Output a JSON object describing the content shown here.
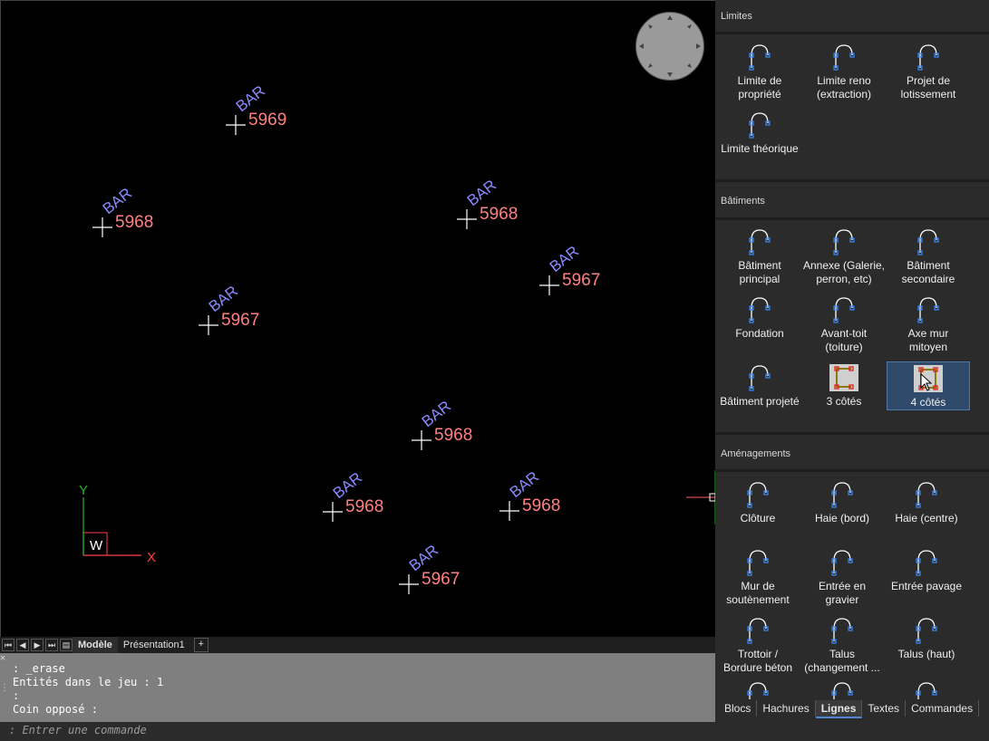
{
  "canvas": {
    "labels": [
      {
        "code": "BAR",
        "number": "5969"
      },
      {
        "code": "BAR",
        "number": "5968"
      },
      {
        "code": "BAR",
        "number": "5968"
      },
      {
        "code": "BAR",
        "number": "5967"
      },
      {
        "code": "BAR",
        "number": "5967"
      },
      {
        "code": "BAR",
        "number": "5968"
      },
      {
        "code": "BAR",
        "number": "5968"
      },
      {
        "code": "BAR",
        "number": "5968"
      },
      {
        "code": "BAR",
        "number": "5967"
      }
    ],
    "ucs": {
      "y": "Y",
      "x": "X",
      "w": "W"
    },
    "colors": {
      "code": "#8a8aff",
      "number": "#ff8080",
      "cross": "#ffffff",
      "axis_y": "#2ab52a",
      "axis_x": "#ff4040"
    }
  },
  "layout_tabs": {
    "model": "Modèle",
    "layout1": "Présentation1",
    "add": "+"
  },
  "command": {
    "history": [
      ": _erase",
      "Entités dans le jeu : 1",
      ":",
      "Coin opposé :"
    ],
    "prompt": ": Entrer une commande"
  },
  "panel": {
    "sections": [
      {
        "title": "Limites"
      },
      {
        "title": "Bâtiments"
      },
      {
        "title": "Aménagements"
      }
    ],
    "limites": [
      {
        "label": "Limite de\npropriété",
        "icon": "arc-line-icon"
      },
      {
        "label": "Limite reno\n(extraction)",
        "icon": "arc-line-icon"
      },
      {
        "label": "Projet de\nlotissement",
        "icon": "arc-line-icon"
      },
      {
        "label": "Limite théorique",
        "icon": "arc-line-icon"
      }
    ],
    "batiments": [
      {
        "label": "Bâtiment\nprincipal",
        "icon": "arc-line-icon"
      },
      {
        "label": "Annexe (Galerie,\nperron, etc)",
        "icon": "arc-line-icon"
      },
      {
        "label": "Bâtiment\nsecondaire",
        "icon": "arc-line-icon"
      },
      {
        "label": "Fondation",
        "icon": "arc-line-icon"
      },
      {
        "label": "Avant-toit\n(toiture)",
        "icon": "arc-line-icon"
      },
      {
        "label": "Axe mur\nmitoyen",
        "icon": "arc-line-icon"
      },
      {
        "label": "Bâtiment projeté",
        "icon": "arc-line-icon"
      },
      {
        "label": "3 côtés",
        "icon": "three-sides-icon"
      },
      {
        "label": "4 côtés",
        "icon": "four-sides-icon"
      }
    ],
    "amenagements": [
      {
        "label": "Clôture",
        "icon": "arc-line-icon"
      },
      {
        "label": "Haie (bord)",
        "icon": "arc-line-icon"
      },
      {
        "label": "Haie (centre)",
        "icon": "arc-line-icon"
      },
      {
        "label": "Mur de\nsoutènement",
        "icon": "arc-line-icon"
      },
      {
        "label": "Entrée en gravier",
        "icon": "arc-line-icon"
      },
      {
        "label": "Entrée pavage",
        "icon": "arc-line-icon"
      },
      {
        "label": "Trottoir /\nBordure béton",
        "icon": "arc-line-icon"
      },
      {
        "label": "Talus\n(changement ...",
        "icon": "arc-line-icon"
      },
      {
        "label": "Talus (haut)",
        "icon": "arc-line-icon"
      }
    ],
    "bottom_tabs": [
      "Blocs",
      "Hachures",
      "Lignes",
      "Textes",
      "Commandes"
    ],
    "active_tab": "Lignes"
  }
}
